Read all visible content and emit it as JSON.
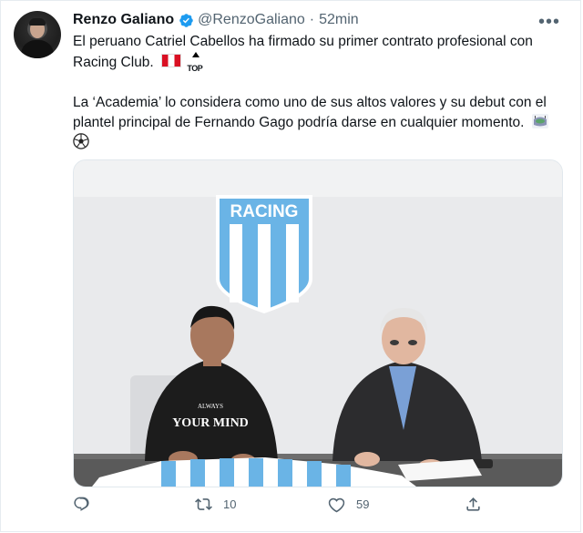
{
  "author": {
    "name": "Renzo Galiano",
    "handle": "@RenzoGaliano",
    "separator": "·",
    "time": "52min"
  },
  "menu": {
    "more_label": "•••"
  },
  "tweet": {
    "paragraph1": "El peruano Catriel Cabellos ha firmado su primer contrato profesional con Racing Club.",
    "paragraph2": "La ‘Academia’ lo considera como uno de sus altos valores y su debut con el plantel principal de Fernando Gago podría darse en cualquier momento.",
    "emoji_top_text": "TOP"
  },
  "media": {
    "crest_text": "RACING",
    "shirt_text": "YOUR MIND",
    "shirt_small_text": "ALWAYS"
  },
  "actions": {
    "reply_icon": "reply-icon",
    "retweet_icon": "retweet-icon",
    "retweet_count": "10",
    "like_icon": "heart-icon",
    "like_count": "59",
    "share_icon": "share-icon"
  },
  "colors": {
    "verified": "#1d9bf0",
    "text_secondary": "#536471",
    "racing_blue": "#6ab4e6",
    "border": "#e6ecf0"
  }
}
